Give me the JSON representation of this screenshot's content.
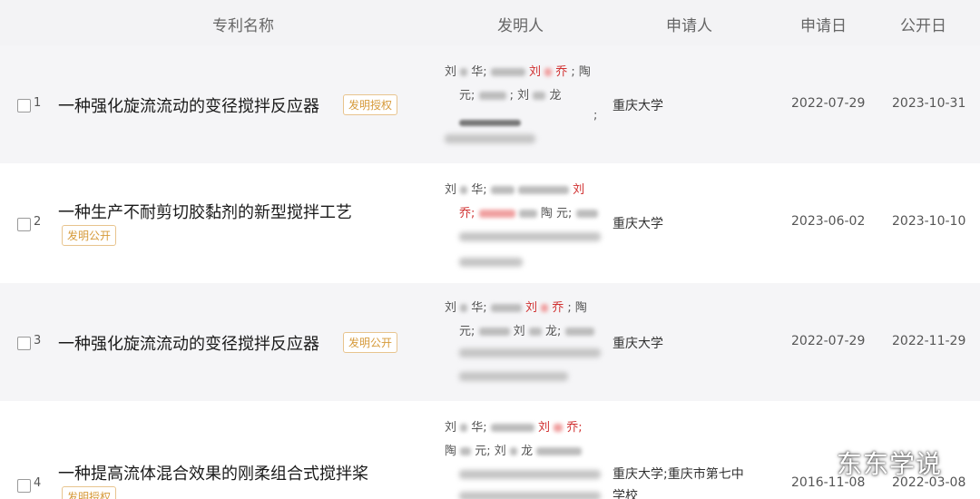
{
  "columns": {
    "name": "专利名称",
    "inventor": "发明人",
    "applicant": "申请人",
    "apply_date": "申请日",
    "publish_date": "公开日"
  },
  "rows": [
    {
      "index": "1",
      "title": "一种强化旋流流动的变径搅拌反应器",
      "badge": "发明授权",
      "inv": {
        "a": "刘",
        "b": "华;",
        "c": "刘",
        "d": "乔",
        "e": "; 陶",
        "f": "元;",
        "g": "; 刘",
        "h": "龙",
        "i": ";"
      },
      "applicant": "重庆大学",
      "apply_date": "2022-07-29",
      "publish_date": "2023-10-31"
    },
    {
      "index": "2",
      "title": "一种生产不耐剪切胶黏剂的新型搅拌工艺",
      "badge": "发明公开",
      "inv": {
        "a": "刘",
        "b": "华;",
        "c": "刘",
        "d": "乔;",
        "e": "陶",
        "f": "元;"
      },
      "applicant": "重庆大学",
      "apply_date": "2023-06-02",
      "publish_date": "2023-10-10"
    },
    {
      "index": "3",
      "title": "一种强化旋流流动的变径搅拌反应器",
      "badge": "发明公开",
      "inv": {
        "a": "刘",
        "b": "华;",
        "c": "刘",
        "d": "乔",
        "e": "; 陶",
        "f": "元;",
        "g": "刘",
        "h": "龙;"
      },
      "applicant": "重庆大学",
      "apply_date": "2022-07-29",
      "publish_date": "2022-11-29"
    },
    {
      "index": "4",
      "title": "一种提高流体混合效果的刚柔组合式搅拌桨",
      "badge": "发明授权",
      "inv": {
        "a": "刘",
        "b": "华;",
        "c": "刘",
        "d": "乔;",
        "e": "陶",
        "f": "元; 刘",
        "g": "龙"
      },
      "applicant_line1": "重庆大学;重庆市第七中",
      "applicant_line2": "学校",
      "apply_date": "2016-11-08",
      "publish_date": "2022-03-08"
    }
  ],
  "watermark": "东东学说",
  "colors": {
    "header_bg": "#f3f3f5",
    "row_shaded_bg": "#f5f5f7",
    "badge": "#d69a3a",
    "highlight_name": "#d03030"
  }
}
